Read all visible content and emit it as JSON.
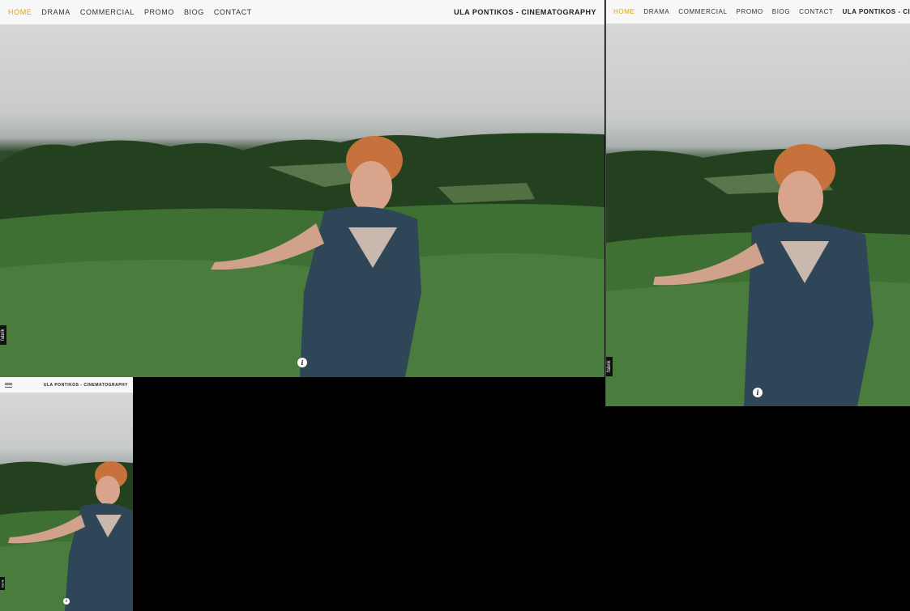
{
  "site": {
    "title": "ULA PONTIKOS - CINEMATOGRAPHY",
    "nav": [
      {
        "label": "HOME",
        "active": true
      },
      {
        "label": "DRAMA",
        "active": false
      },
      {
        "label": "COMMERCIAL",
        "active": false
      },
      {
        "label": "PROMO",
        "active": false
      },
      {
        "label": "BIOG",
        "active": false
      },
      {
        "label": "CONTACT",
        "active": false
      }
    ],
    "side_tab": "fabrik",
    "info_icon": "i"
  },
  "colors": {
    "accent": "#e0a800",
    "nav_background": "#f7f7f7",
    "page_background": "#000000"
  },
  "icons": {
    "info": "info-icon",
    "menu": "hamburger-menu-icon"
  }
}
